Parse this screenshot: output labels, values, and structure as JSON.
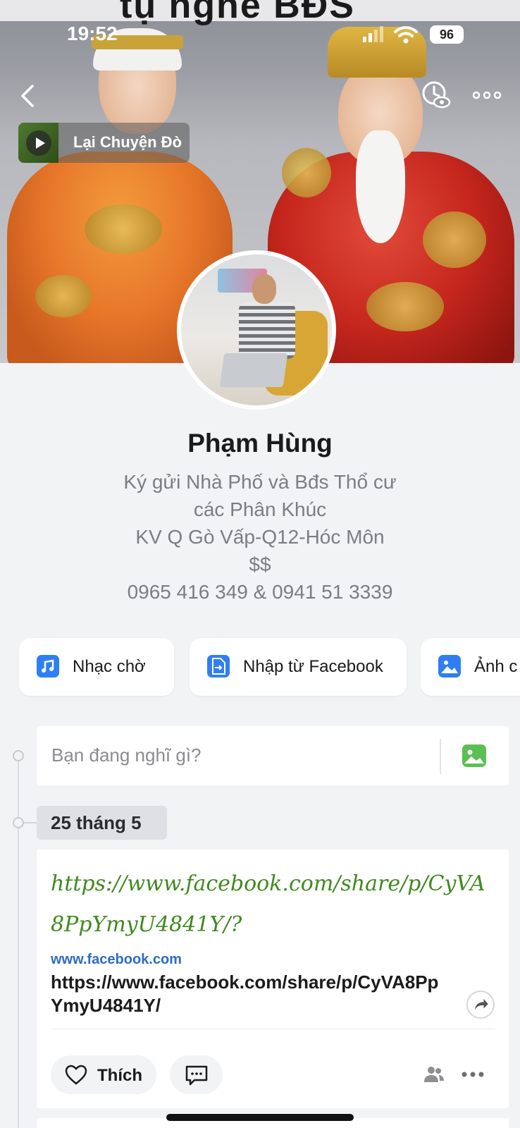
{
  "status_bar": {
    "time": "19:52",
    "battery": "96"
  },
  "cover": {
    "top_text": "tụ nghề BĐS"
  },
  "music": {
    "title": "Lại Chuyện Đò"
  },
  "profile": {
    "name": "Phạm Hùng",
    "bio": [
      "Ký gửi Nhà Phố và Bđs Thổ cư",
      "các Phân Khúc",
      "KV Q Gò Vấp-Q12-Hóc Môn",
      "$$",
      "0965 416 349 & 0941 51 3339"
    ]
  },
  "actions": [
    {
      "label": "Nhạc chờ",
      "icon": "music-note-icon"
    },
    {
      "label": "Nhập từ Facebook",
      "icon": "import-file-icon"
    },
    {
      "label": "Ảnh c",
      "icon": "photo-icon"
    }
  ],
  "composer": {
    "placeholder": "Bạn đang nghĩ gì?"
  },
  "timeline": {
    "date": "25 tháng 5"
  },
  "post": {
    "text": "https://www.facebook.com/share/p/CyVA8PpYmyU4841Y/?",
    "link_domain": "www.facebook.com",
    "link_url": "https://www.facebook.com/share/p/CyVA8PpYmyU4841Y/",
    "like_label": "Thích"
  },
  "colors": {
    "accent": "#2f7ff3",
    "post_text": "#3f8a1f",
    "link_domain": "#2d6cc2",
    "photo_icon": "#5bbf54"
  }
}
